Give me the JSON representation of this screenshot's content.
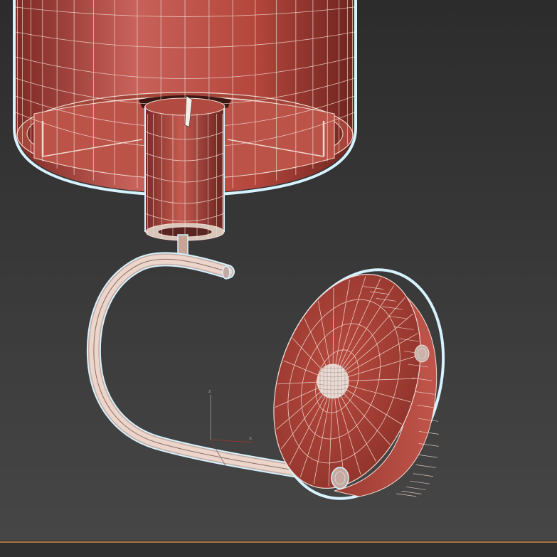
{
  "viewport": {
    "background_top": "#2c2c2c",
    "background_bottom": "#474747",
    "mesh_fill": "#b5473d",
    "mesh_fill_dark": "#7e2a24",
    "mesh_fill_light": "#c8625a",
    "wire_color": "#f1d9cf",
    "selection_outline": "#d6f3ff",
    "bottom_bar_color": "#a77742"
  },
  "gizmo": {
    "z_label": "z",
    "x_label": "x"
  },
  "model": {
    "parts": [
      "lampshade",
      "shade-socket",
      "stem-pipe",
      "curved-arm",
      "wall-plate",
      "plate-knob",
      "plate-screw"
    ]
  }
}
